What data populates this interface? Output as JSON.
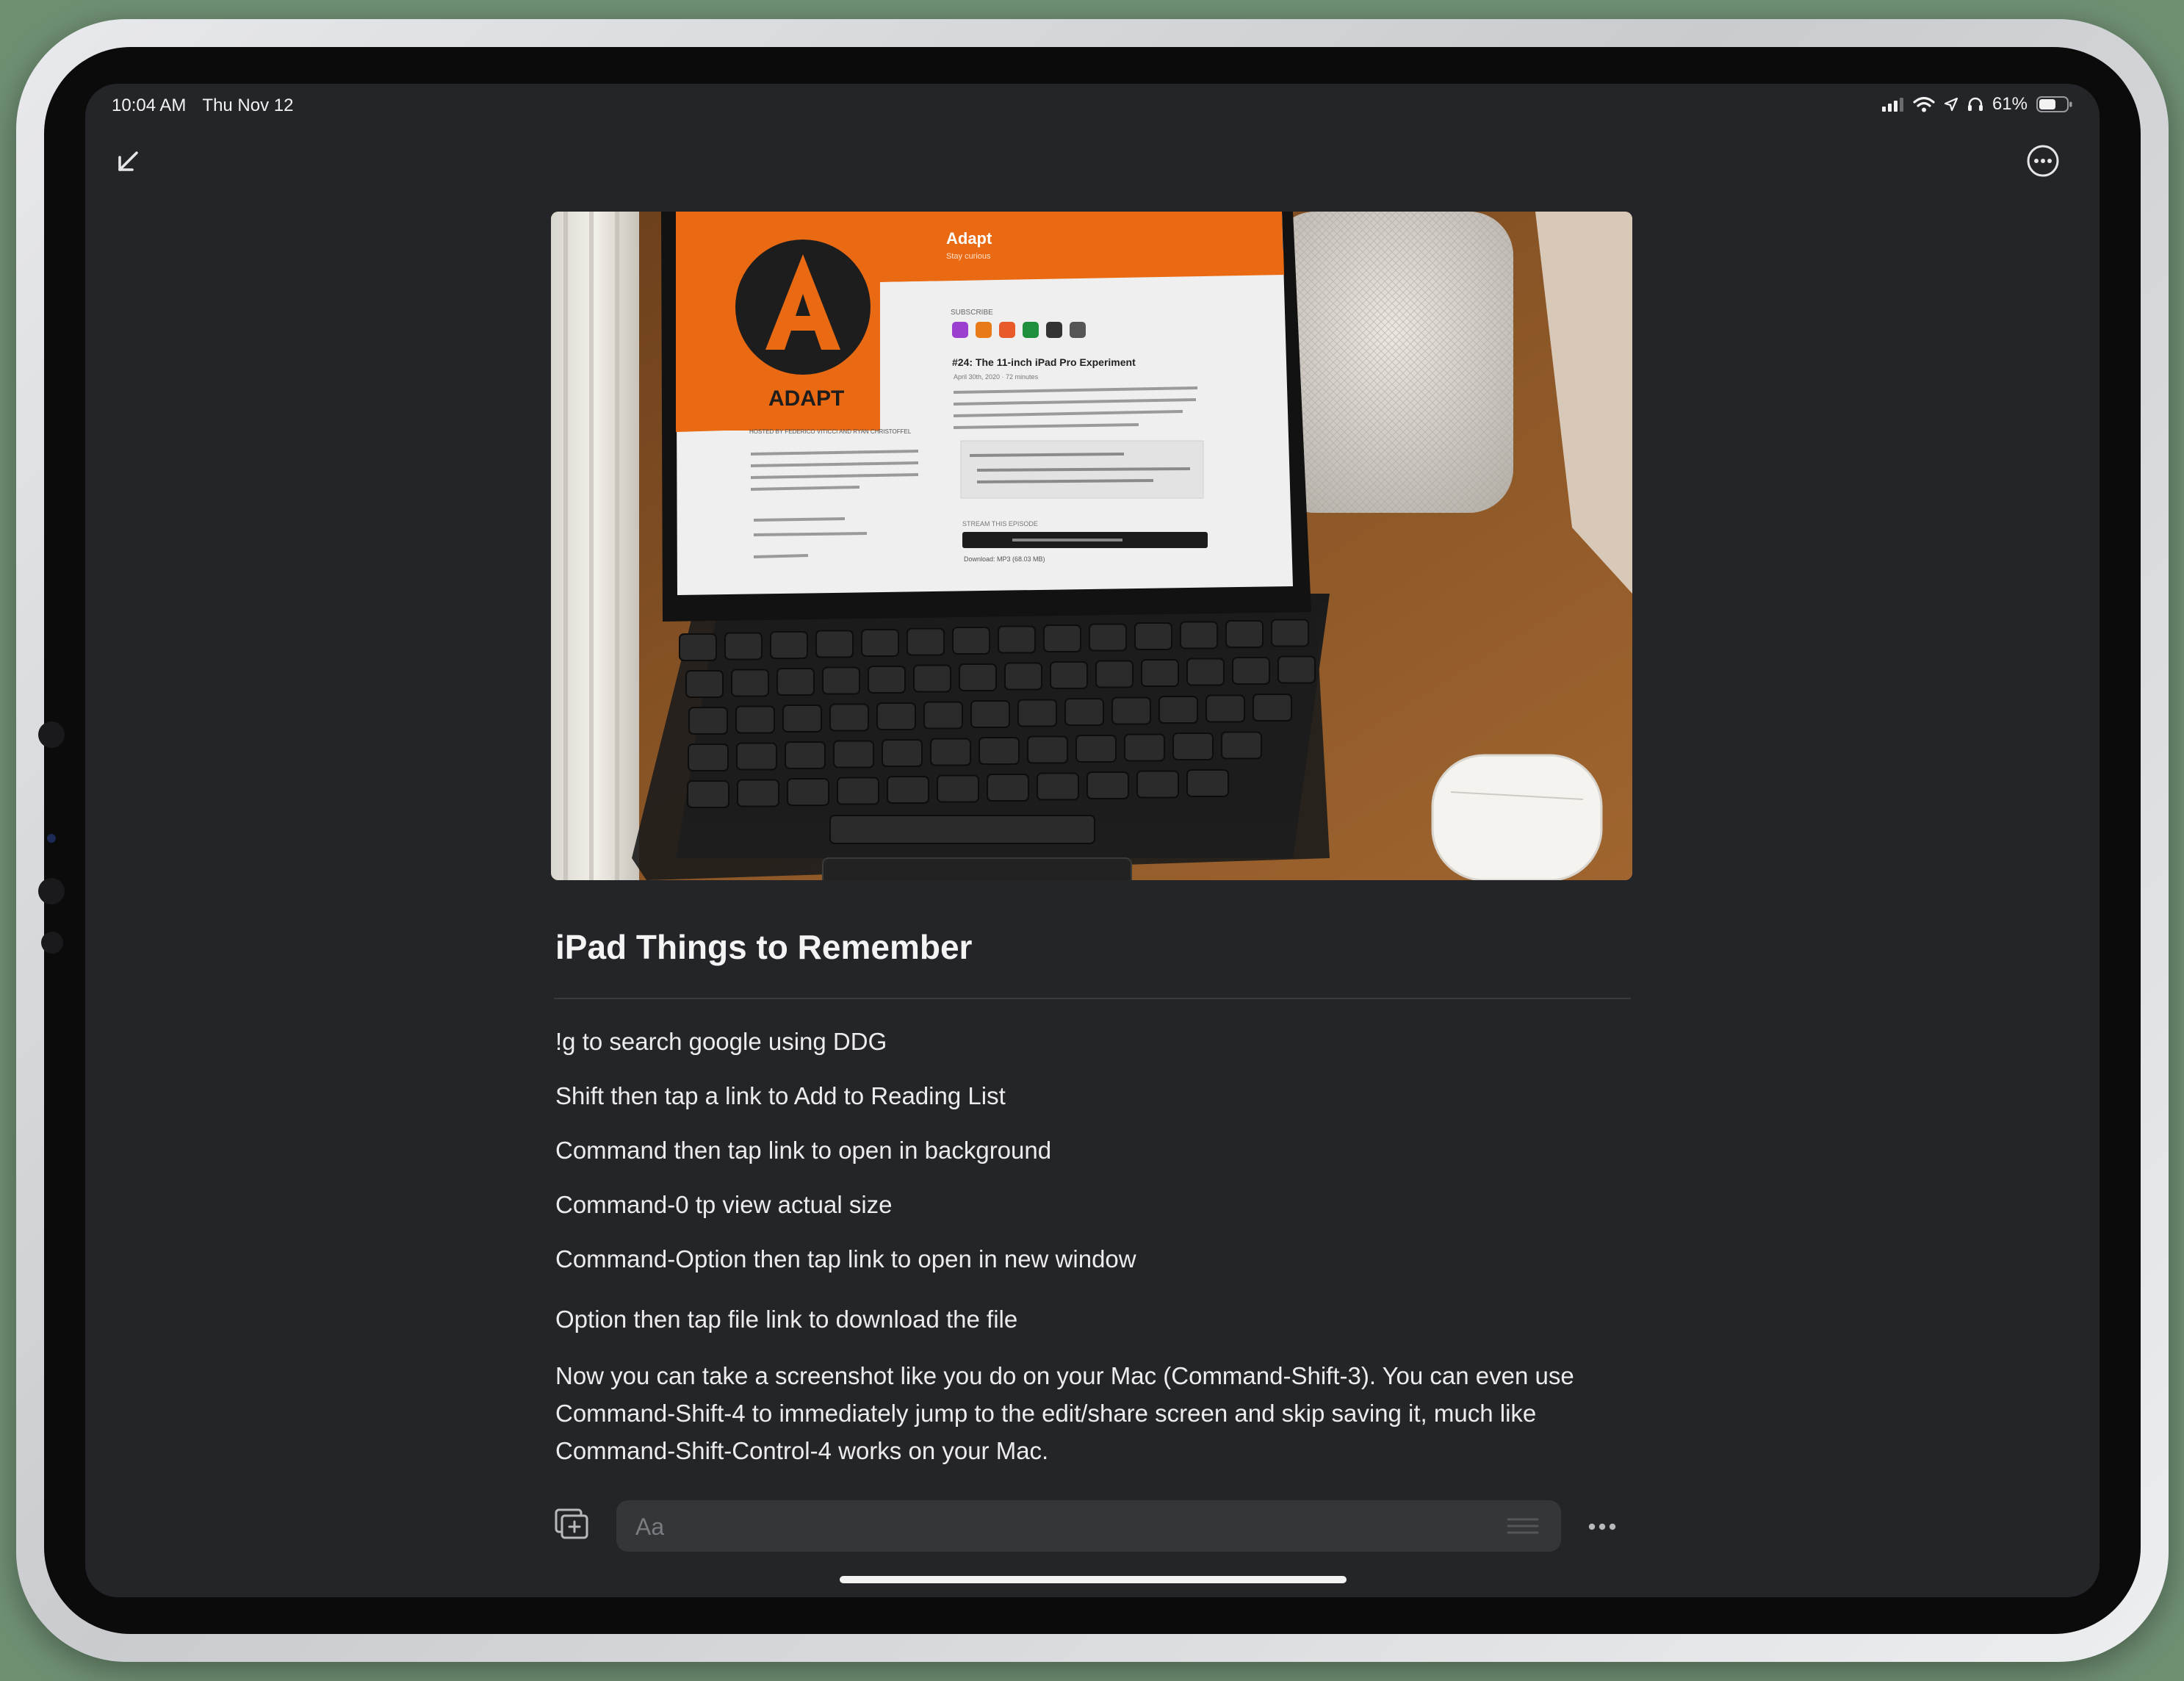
{
  "status_bar": {
    "time": "10:04 AM",
    "date": "Thu Nov 12",
    "battery_percent": "61%",
    "battery_level": 0.61,
    "icons": [
      "cellular-icon",
      "wifi-icon",
      "location-icon",
      "headphones-icon",
      "battery-icon"
    ]
  },
  "toolbar": {
    "collapse_icon": "arrow-down-left-icon",
    "more_icon": "ellipsis-circle-icon"
  },
  "hero_image": {
    "app_name": "Adapt",
    "app_tagline": "Stay curious",
    "logo_text": "ADAPT",
    "subscribe_label": "SUBSCRIBE",
    "episode_title": "#24: The 11-inch iPad Pro Experiment",
    "episode_meta": "April 30th, 2020 · 72 minutes",
    "hosted_by": "HOSTED BY FEDERICO VITICCI AND RYAN CHRISTOFFEL",
    "stream_label": "STREAM THIS EPISODE",
    "download_label": "Download: MP3 (68.03 MB)"
  },
  "note": {
    "title": "iPad Things to Remember",
    "lines": [
      "!g to search google using DDG",
      "Shift then tap a link to Add to Reading List",
      "Command then tap link to open in background",
      "Command-0 tp view actual size",
      "Command-Option then tap link to open in new window",
      "Option then tap file link to download the file"
    ],
    "paragraph": "Now you can take a screenshot like you do on your Mac (Command-Shift-3). You can even use Command-Shift-4 to immediately jump to the edit/share screen and skip saving it, much like Command-Shift-Control-4 works on your Mac."
  },
  "bottom_bar": {
    "add_icon": "add-block-icon",
    "input_placeholder": "Aa",
    "format_icon": "text-format-icon",
    "more_icon": "ellipsis-icon"
  }
}
